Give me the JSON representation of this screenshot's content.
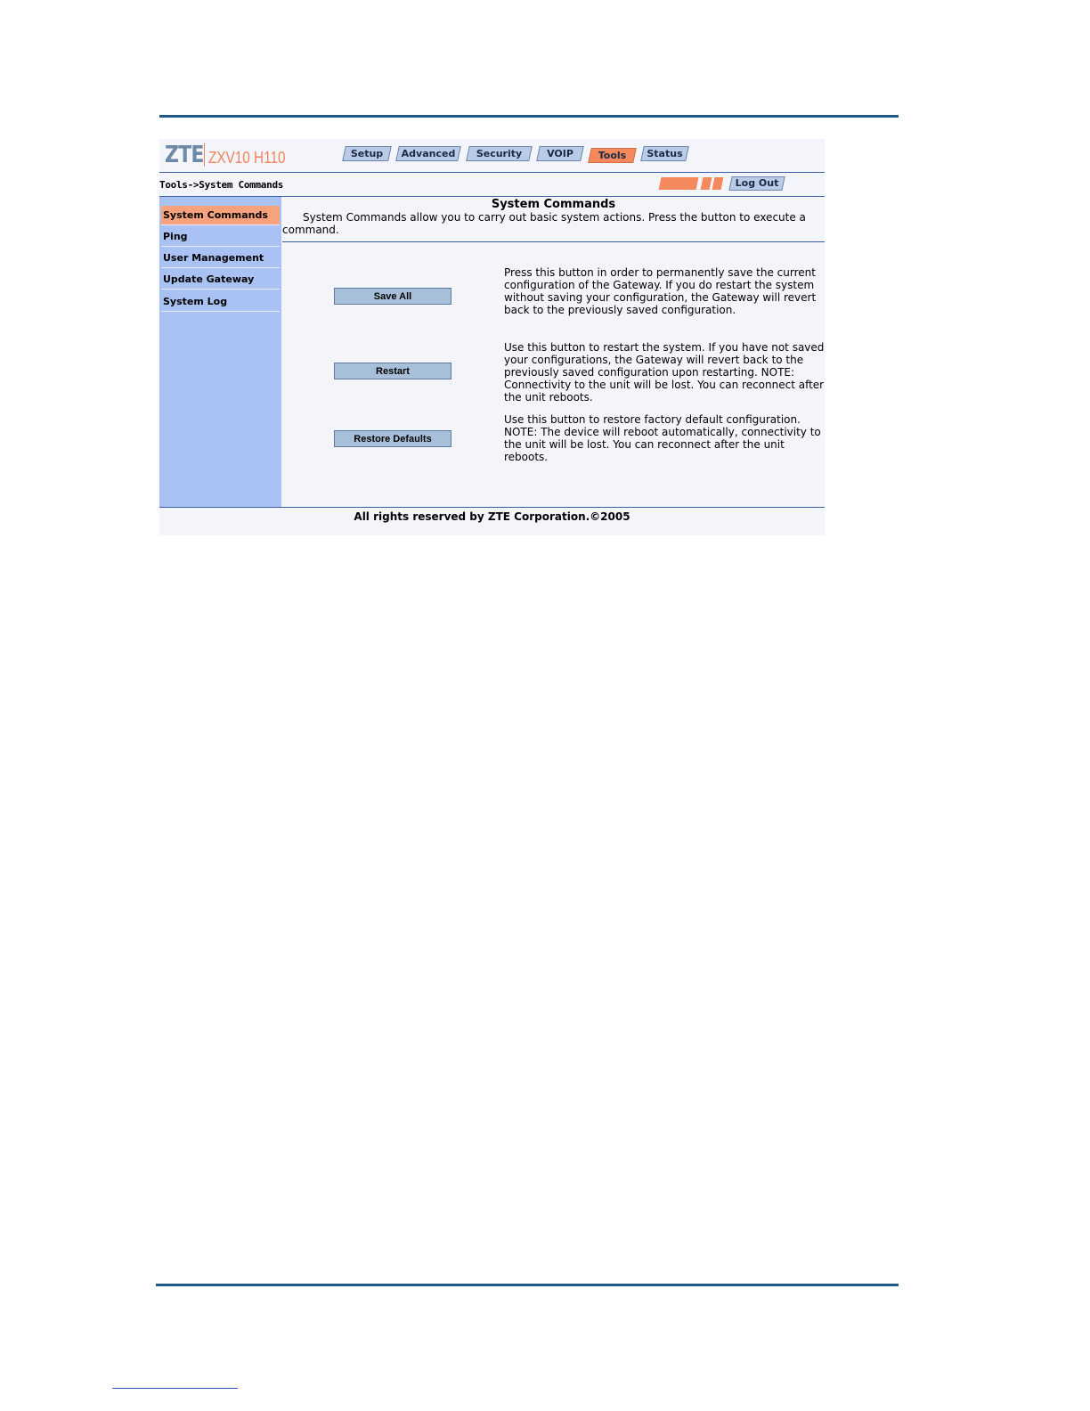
{
  "logo": {
    "brand": "ZTE",
    "model": "ZXV10 H110"
  },
  "tabs": [
    {
      "label": "Setup"
    },
    {
      "label": "Advanced"
    },
    {
      "label": "Security"
    },
    {
      "label": "VOIP"
    },
    {
      "label": "Tools"
    },
    {
      "label": "Status"
    }
  ],
  "active_tab": "Tools",
  "breadcrumb": "Tools->System Commands",
  "logout_label": "Log Out",
  "sidebar": {
    "items": [
      {
        "label": "System Commands"
      },
      {
        "label": "Ping"
      },
      {
        "label": "User Management"
      },
      {
        "label": "Update Gateway"
      },
      {
        "label": "System Log"
      }
    ],
    "active": "System Commands"
  },
  "main": {
    "title": "System Commands",
    "description": "System Commands allow you to carry out basic system actions. Press the button to execute a command.",
    "commands": [
      {
        "button": "Save All",
        "text": "Press this button in order to permanently save the current configuration of the Gateway. If you do restart the system without saving your configuration, the Gateway will revert back to the previously saved configuration."
      },
      {
        "button": "Restart",
        "text": "Use this button to restart the system. If you have not saved your configurations, the Gateway will revert back to the previously saved configuration upon restarting. NOTE: Connectivity to the unit will be lost. You can reconnect after the unit reboots."
      },
      {
        "button": "Restore Defaults",
        "text": "Use this button to restore factory default configuration. NOTE: The device will reboot automatically, connectivity to the unit will be lost. You can reconnect after the unit reboots."
      }
    ]
  },
  "footer": "All rights reserved by ZTE Corporation.©2005",
  "colors": {
    "accent_orange": "#f5895e",
    "sidebar_blue": "#a9c1f3",
    "tab_blue": "#b9cbe6",
    "rule_blue": "#1d5a8a"
  }
}
